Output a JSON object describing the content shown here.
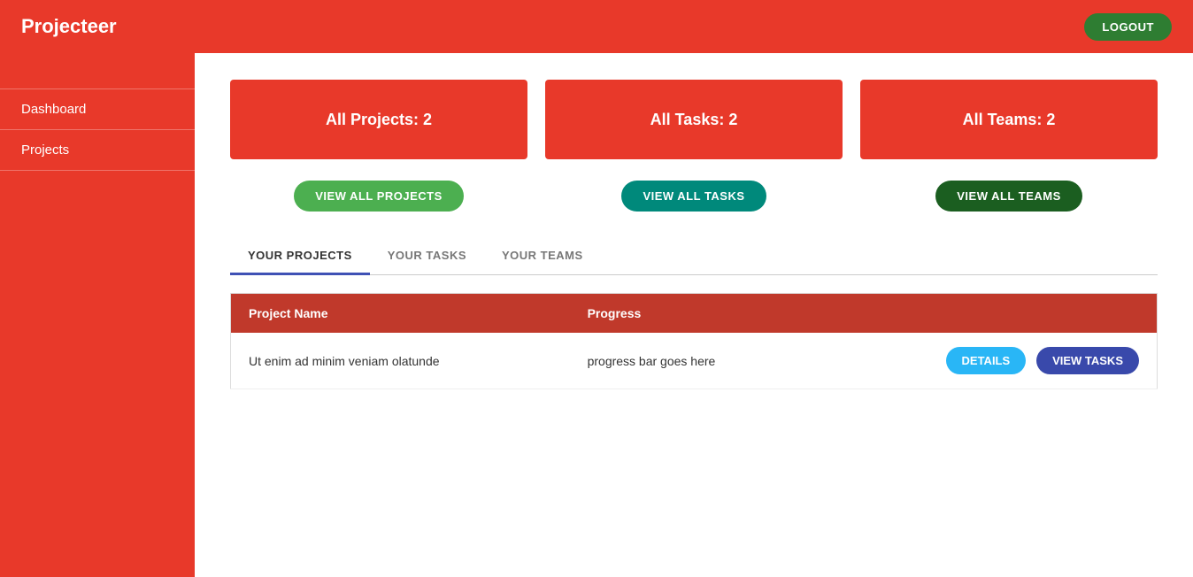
{
  "header": {
    "title": "Projecteer",
    "logout_label": "LOGOUT"
  },
  "sidebar": {
    "items": [
      {
        "label": "Dashboard"
      },
      {
        "label": "Projects"
      }
    ]
  },
  "stats": [
    {
      "label": "All Projects: 2"
    },
    {
      "label": "All Tasks: 2"
    },
    {
      "label": "All Teams: 2"
    }
  ],
  "view_buttons": [
    {
      "label": "VIEW ALL PROJECTS",
      "style": "green"
    },
    {
      "label": "VIEW ALL TASKS",
      "style": "teal"
    },
    {
      "label": "VIEW ALL TEAMS",
      "style": "dark"
    }
  ],
  "tabs": [
    {
      "label": "YOUR PROJECTS",
      "active": true
    },
    {
      "label": "YOUR TASKS",
      "active": false
    },
    {
      "label": "YOUR TEAMS",
      "active": false
    }
  ],
  "table": {
    "headers": [
      {
        "label": "Project Name"
      },
      {
        "label": "Progress"
      },
      {
        "label": ""
      }
    ],
    "rows": [
      {
        "project_name": "Ut enim ad minim veniam olatunde",
        "progress_text": "progress bar goes here",
        "details_label": "DETAILS",
        "view_tasks_label": "VIEW TASKS"
      }
    ]
  }
}
